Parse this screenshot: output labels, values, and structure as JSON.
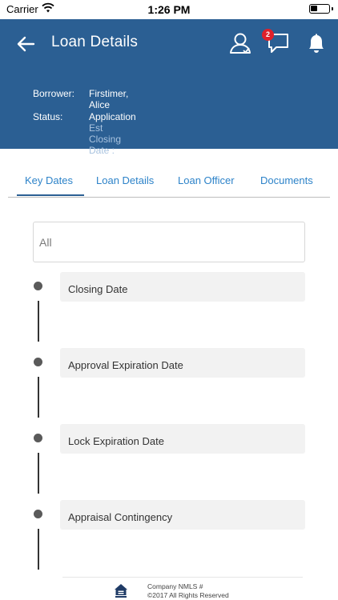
{
  "status_bar": {
    "carrier": "Carrier",
    "time": "1:26 PM"
  },
  "header": {
    "title": "Loan Details",
    "notification_count": "2",
    "background_color": "#2b5f93",
    "borrower_label": "Borrower:",
    "borrower_value": "Firstimer, Alice",
    "status_label": "Status:",
    "status_value": "Application",
    "closing_date_label": "Est Closing Date :",
    "icons": [
      "back-arrow-icon",
      "profile-icon",
      "chat-icon",
      "bell-icon"
    ]
  },
  "tabs": [
    {
      "label": "Key Dates",
      "active": true
    },
    {
      "label": "Loan Details",
      "active": false
    },
    {
      "label": "Loan Officer",
      "active": false
    },
    {
      "label": "Documents",
      "active": false
    }
  ],
  "filter": {
    "value": "All"
  },
  "timeline": [
    {
      "label": "Closing Date"
    },
    {
      "label": "Approval Expiration Date"
    },
    {
      "label": "Lock Expiration Date"
    },
    {
      "label": "Appraisal Contingency"
    }
  ],
  "footer": {
    "logo": "equal-housing-opportunity-icon",
    "line1": "Company NMLS #",
    "line2": "©2017  All Rights Reserved"
  },
  "colors": {
    "accent": "#2d83c9",
    "header": "#2b5f93",
    "badge": "#e0202a"
  }
}
